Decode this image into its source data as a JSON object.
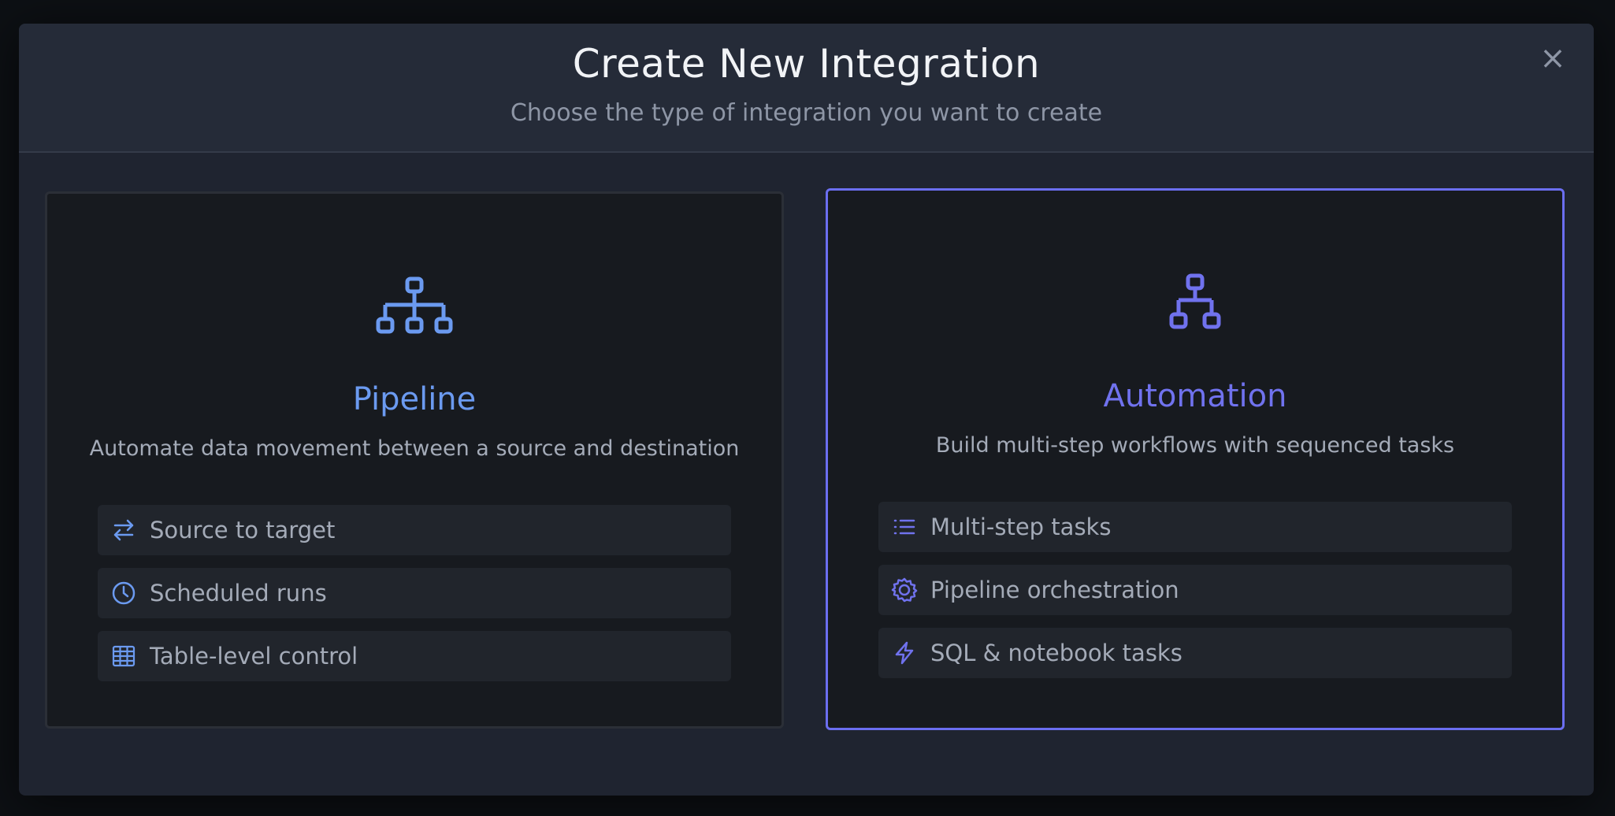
{
  "modal": {
    "title": "Create New Integration",
    "subtitle": "Choose the type of integration you want to create",
    "close_label": "×"
  },
  "cards": [
    {
      "id": "pipeline",
      "title": "Pipeline",
      "description": "Automate data movement between a source and destination",
      "icon": "hierarchy-icon",
      "accent": "#6b9af0",
      "selected": false,
      "features": [
        {
          "icon": "arrows-left-right-icon",
          "label": "Source to target"
        },
        {
          "icon": "clock-icon",
          "label": "Scheduled runs"
        },
        {
          "icon": "table-icon",
          "label": "Table-level control"
        }
      ]
    },
    {
      "id": "automation",
      "title": "Automation",
      "description": "Build multi-step workflows with sequenced tasks",
      "icon": "workflow-icon",
      "accent": "#7072ee",
      "selected": true,
      "features": [
        {
          "icon": "list-icon",
          "label": "Multi-step tasks"
        },
        {
          "icon": "gear-icon",
          "label": "Pipeline orchestration"
        },
        {
          "icon": "lightning-icon",
          "label": "SQL & notebook tasks"
        }
      ]
    }
  ],
  "colors": {
    "modal_bg": "#1f2430",
    "header_bg": "#252b38",
    "card_bg": "#171a1f",
    "selected_border": "#6b6ef0"
  }
}
